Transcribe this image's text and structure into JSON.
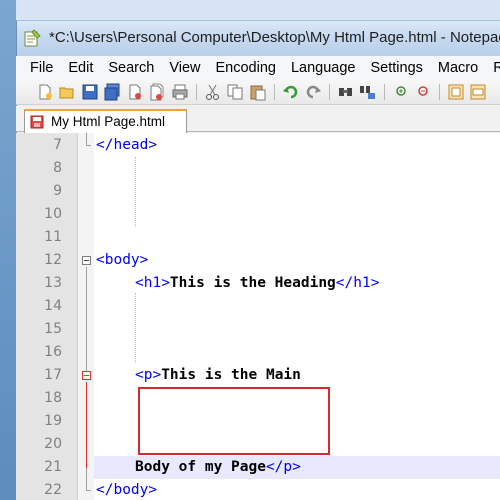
{
  "window": {
    "title": "*C:\\Users\\Personal Computer\\Desktop\\My Html Page.html - Notepad++"
  },
  "menu": [
    "File",
    "Edit",
    "Search",
    "View",
    "Encoding",
    "Language",
    "Settings",
    "Macro",
    "Run"
  ],
  "toolbar": {
    "icons": [
      "new-file-icon",
      "open-file-icon",
      "save-icon",
      "save-all-icon",
      "close-icon",
      "close-all-icon",
      "print-icon",
      "cut-icon",
      "copy-icon",
      "paste-icon",
      "undo-icon",
      "redo-icon",
      "find-icon",
      "replace-icon",
      "zoom-in-icon",
      "zoom-out-icon",
      "sync-vertical-icon",
      "sync-horizontal-icon"
    ]
  },
  "tabs": [
    {
      "label": "My Html Page.html",
      "modified": true
    }
  ],
  "editor": {
    "current_line": 21,
    "lines": [
      {
        "num": "7",
        "code": "</head>"
      },
      {
        "num": "8",
        "code": ""
      },
      {
        "num": "9",
        "code": ""
      },
      {
        "num": "10",
        "code": ""
      },
      {
        "num": "11",
        "code": ""
      },
      {
        "num": "12",
        "code": "<body>"
      },
      {
        "num": "13",
        "code": "    <h1>This is the Heading</h1>"
      },
      {
        "num": "14",
        "code": ""
      },
      {
        "num": "15",
        "code": ""
      },
      {
        "num": "16",
        "code": ""
      },
      {
        "num": "17",
        "code": "    <p>This is the Main"
      },
      {
        "num": "18",
        "code": ""
      },
      {
        "num": "19",
        "code": ""
      },
      {
        "num": "20",
        "code": ""
      },
      {
        "num": "21",
        "code": "    Body of my Page</p>"
      },
      {
        "num": "22",
        "code": "</body>"
      }
    ],
    "segments": {
      "l7_tag": "</head>",
      "l12_tag": "<body>",
      "l13_open": "<h1>",
      "l13_text": "This is the Heading",
      "l13_close": "</h1>",
      "l17_open": "<p>",
      "l17_text": "This is the Main",
      "l21_text": "Body of my Page",
      "l21_close": "</p>",
      "l22_tag": "</body>"
    }
  },
  "colors": {
    "tag": "#0000ff",
    "current_line_bg": "#e8e8ff",
    "highlight_box": "#d42a2a",
    "tab_accent": "#f4a339"
  }
}
